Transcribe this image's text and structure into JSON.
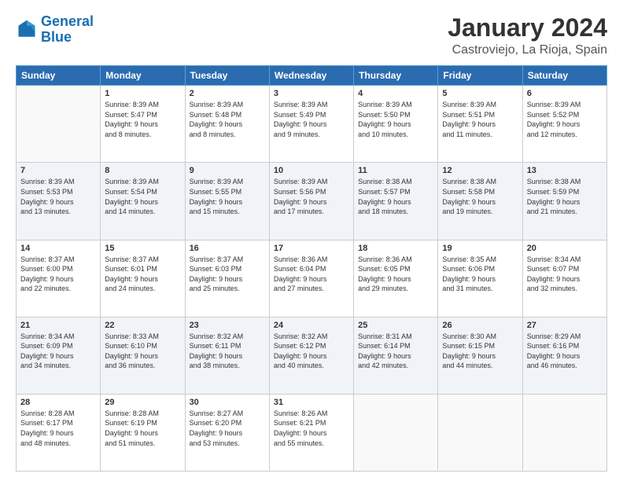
{
  "logo": {
    "text_general": "General",
    "text_blue": "Blue"
  },
  "title": "January 2024",
  "subtitle": "Castroviejo, La Rioja, Spain",
  "days_of_week": [
    "Sunday",
    "Monday",
    "Tuesday",
    "Wednesday",
    "Thursday",
    "Friday",
    "Saturday"
  ],
  "weeks": [
    [
      {
        "num": "",
        "empty": true
      },
      {
        "num": "1",
        "sunrise": "Sunrise: 8:39 AM",
        "sunset": "Sunset: 5:47 PM",
        "daylight": "Daylight: 9 hours and 8 minutes."
      },
      {
        "num": "2",
        "sunrise": "Sunrise: 8:39 AM",
        "sunset": "Sunset: 5:48 PM",
        "daylight": "Daylight: 9 hours and 8 minutes."
      },
      {
        "num": "3",
        "sunrise": "Sunrise: 8:39 AM",
        "sunset": "Sunset: 5:49 PM",
        "daylight": "Daylight: 9 hours and 9 minutes."
      },
      {
        "num": "4",
        "sunrise": "Sunrise: 8:39 AM",
        "sunset": "Sunset: 5:50 PM",
        "daylight": "Daylight: 9 hours and 10 minutes."
      },
      {
        "num": "5",
        "sunrise": "Sunrise: 8:39 AM",
        "sunset": "Sunset: 5:51 PM",
        "daylight": "Daylight: 9 hours and 11 minutes."
      },
      {
        "num": "6",
        "sunrise": "Sunrise: 8:39 AM",
        "sunset": "Sunset: 5:52 PM",
        "daylight": "Daylight: 9 hours and 12 minutes."
      }
    ],
    [
      {
        "num": "7",
        "sunrise": "Sunrise: 8:39 AM",
        "sunset": "Sunset: 5:53 PM",
        "daylight": "Daylight: 9 hours and 13 minutes."
      },
      {
        "num": "8",
        "sunrise": "Sunrise: 8:39 AM",
        "sunset": "Sunset: 5:54 PM",
        "daylight": "Daylight: 9 hours and 14 minutes."
      },
      {
        "num": "9",
        "sunrise": "Sunrise: 8:39 AM",
        "sunset": "Sunset: 5:55 PM",
        "daylight": "Daylight: 9 hours and 15 minutes."
      },
      {
        "num": "10",
        "sunrise": "Sunrise: 8:39 AM",
        "sunset": "Sunset: 5:56 PM",
        "daylight": "Daylight: 9 hours and 17 minutes."
      },
      {
        "num": "11",
        "sunrise": "Sunrise: 8:38 AM",
        "sunset": "Sunset: 5:57 PM",
        "daylight": "Daylight: 9 hours and 18 minutes."
      },
      {
        "num": "12",
        "sunrise": "Sunrise: 8:38 AM",
        "sunset": "Sunset: 5:58 PM",
        "daylight": "Daylight: 9 hours and 19 minutes."
      },
      {
        "num": "13",
        "sunrise": "Sunrise: 8:38 AM",
        "sunset": "Sunset: 5:59 PM",
        "daylight": "Daylight: 9 hours and 21 minutes."
      }
    ],
    [
      {
        "num": "14",
        "sunrise": "Sunrise: 8:37 AM",
        "sunset": "Sunset: 6:00 PM",
        "daylight": "Daylight: 9 hours and 22 minutes."
      },
      {
        "num": "15",
        "sunrise": "Sunrise: 8:37 AM",
        "sunset": "Sunset: 6:01 PM",
        "daylight": "Daylight: 9 hours and 24 minutes."
      },
      {
        "num": "16",
        "sunrise": "Sunrise: 8:37 AM",
        "sunset": "Sunset: 6:03 PM",
        "daylight": "Daylight: 9 hours and 25 minutes."
      },
      {
        "num": "17",
        "sunrise": "Sunrise: 8:36 AM",
        "sunset": "Sunset: 6:04 PM",
        "daylight": "Daylight: 9 hours and 27 minutes."
      },
      {
        "num": "18",
        "sunrise": "Sunrise: 8:36 AM",
        "sunset": "Sunset: 6:05 PM",
        "daylight": "Daylight: 9 hours and 29 minutes."
      },
      {
        "num": "19",
        "sunrise": "Sunrise: 8:35 AM",
        "sunset": "Sunset: 6:06 PM",
        "daylight": "Daylight: 9 hours and 31 minutes."
      },
      {
        "num": "20",
        "sunrise": "Sunrise: 8:34 AM",
        "sunset": "Sunset: 6:07 PM",
        "daylight": "Daylight: 9 hours and 32 minutes."
      }
    ],
    [
      {
        "num": "21",
        "sunrise": "Sunrise: 8:34 AM",
        "sunset": "Sunset: 6:09 PM",
        "daylight": "Daylight: 9 hours and 34 minutes."
      },
      {
        "num": "22",
        "sunrise": "Sunrise: 8:33 AM",
        "sunset": "Sunset: 6:10 PM",
        "daylight": "Daylight: 9 hours and 36 minutes."
      },
      {
        "num": "23",
        "sunrise": "Sunrise: 8:32 AM",
        "sunset": "Sunset: 6:11 PM",
        "daylight": "Daylight: 9 hours and 38 minutes."
      },
      {
        "num": "24",
        "sunrise": "Sunrise: 8:32 AM",
        "sunset": "Sunset: 6:12 PM",
        "daylight": "Daylight: 9 hours and 40 minutes."
      },
      {
        "num": "25",
        "sunrise": "Sunrise: 8:31 AM",
        "sunset": "Sunset: 6:14 PM",
        "daylight": "Daylight: 9 hours and 42 minutes."
      },
      {
        "num": "26",
        "sunrise": "Sunrise: 8:30 AM",
        "sunset": "Sunset: 6:15 PM",
        "daylight": "Daylight: 9 hours and 44 minutes."
      },
      {
        "num": "27",
        "sunrise": "Sunrise: 8:29 AM",
        "sunset": "Sunset: 6:16 PM",
        "daylight": "Daylight: 9 hours and 46 minutes."
      }
    ],
    [
      {
        "num": "28",
        "sunrise": "Sunrise: 8:28 AM",
        "sunset": "Sunset: 6:17 PM",
        "daylight": "Daylight: 9 hours and 48 minutes."
      },
      {
        "num": "29",
        "sunrise": "Sunrise: 8:28 AM",
        "sunset": "Sunset: 6:19 PM",
        "daylight": "Daylight: 9 hours and 51 minutes."
      },
      {
        "num": "30",
        "sunrise": "Sunrise: 8:27 AM",
        "sunset": "Sunset: 6:20 PM",
        "daylight": "Daylight: 9 hours and 53 minutes."
      },
      {
        "num": "31",
        "sunrise": "Sunrise: 8:26 AM",
        "sunset": "Sunset: 6:21 PM",
        "daylight": "Daylight: 9 hours and 55 minutes."
      },
      {
        "num": "",
        "empty": true
      },
      {
        "num": "",
        "empty": true
      },
      {
        "num": "",
        "empty": true
      }
    ]
  ]
}
